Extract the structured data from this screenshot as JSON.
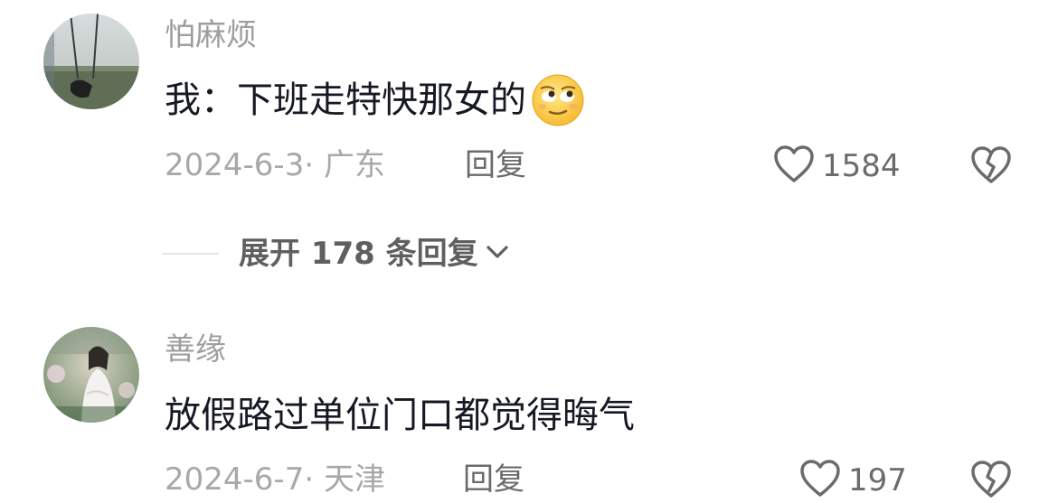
{
  "comments": [
    {
      "username": "怕麻烦",
      "text": "我：下班走特快那女的",
      "emoji": "eye-roll-face-emoji",
      "date_location": "2024-6-3· 广东",
      "reply_label": "回复",
      "likes": "1584",
      "avatar": "swing-landscape-photo"
    },
    {
      "username": "善缘",
      "text": "放假路过单位门口都觉得晦气",
      "date_location": "2024-6-7· 天津",
      "reply_label": "回复",
      "likes": "197",
      "avatar": "woman-in-white-photo"
    }
  ],
  "expand_replies": {
    "label": "展开 178 条回复"
  },
  "icons": {
    "like": "heart-outline-icon",
    "dislike": "broken-heart-icon",
    "expand": "chevron-down-icon"
  },
  "colors": {
    "text_primary": "#161823",
    "text_secondary": "#9e9e9e",
    "action": "#6b6b6b"
  }
}
